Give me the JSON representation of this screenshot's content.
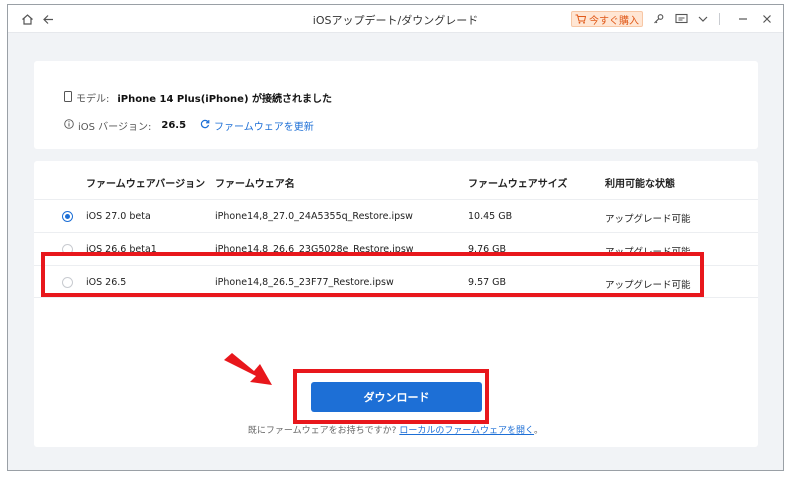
{
  "titlebar": {
    "title": "iOSアップデート/ダウングレード",
    "buy_label": "今すぐ購入",
    "icons": [
      "home-icon",
      "back-icon",
      "cart-icon",
      "key-icon",
      "feedback-icon",
      "chevron-down-icon",
      "minimize-icon",
      "close-icon"
    ]
  },
  "device": {
    "model_label": "モデル:",
    "model_value": "iPhone 14 Plus(iPhone) が接続されました",
    "version_label": "iOS バージョン:",
    "version_value": "26.5",
    "update_firmware_link": "ファームウェアを更新"
  },
  "firmware_table": {
    "headers": [
      "ファームウェアバージョン",
      "ファームウェア名",
      "ファームウェアサイズ",
      "利用可能な状態"
    ],
    "rows": [
      {
        "version": "iOS 27.0 beta",
        "name": "iPhone14,8_27.0_24A5355q_Restore.ipsw",
        "size": "10.45 GB",
        "status": "アップグレード可能",
        "selected": true
      },
      {
        "version": "iOS 26.6 beta1",
        "name": "iPhone14,8_26.6_23G5028e_Restore.ipsw",
        "size": "9.76 GB",
        "status": "アップグレード可能",
        "selected": false
      },
      {
        "version": "iOS 26.5",
        "name": "iPhone14,8_26.5_23F77_Restore.ipsw",
        "size": "9.57 GB",
        "status": "アップグレード可能",
        "selected": false
      }
    ]
  },
  "actions": {
    "download_label": "ダウンロード",
    "footer_prefix": "既にファームウェアをお持ちですか?",
    "footer_link": "ローカルのファームウェアを開く",
    "footer_suffix": "。"
  },
  "colors": {
    "accent": "#1d6fd6",
    "highlight": "#e8171c",
    "buy_bg": "#ffe6d4",
    "buy_text": "#e05a1a"
  }
}
